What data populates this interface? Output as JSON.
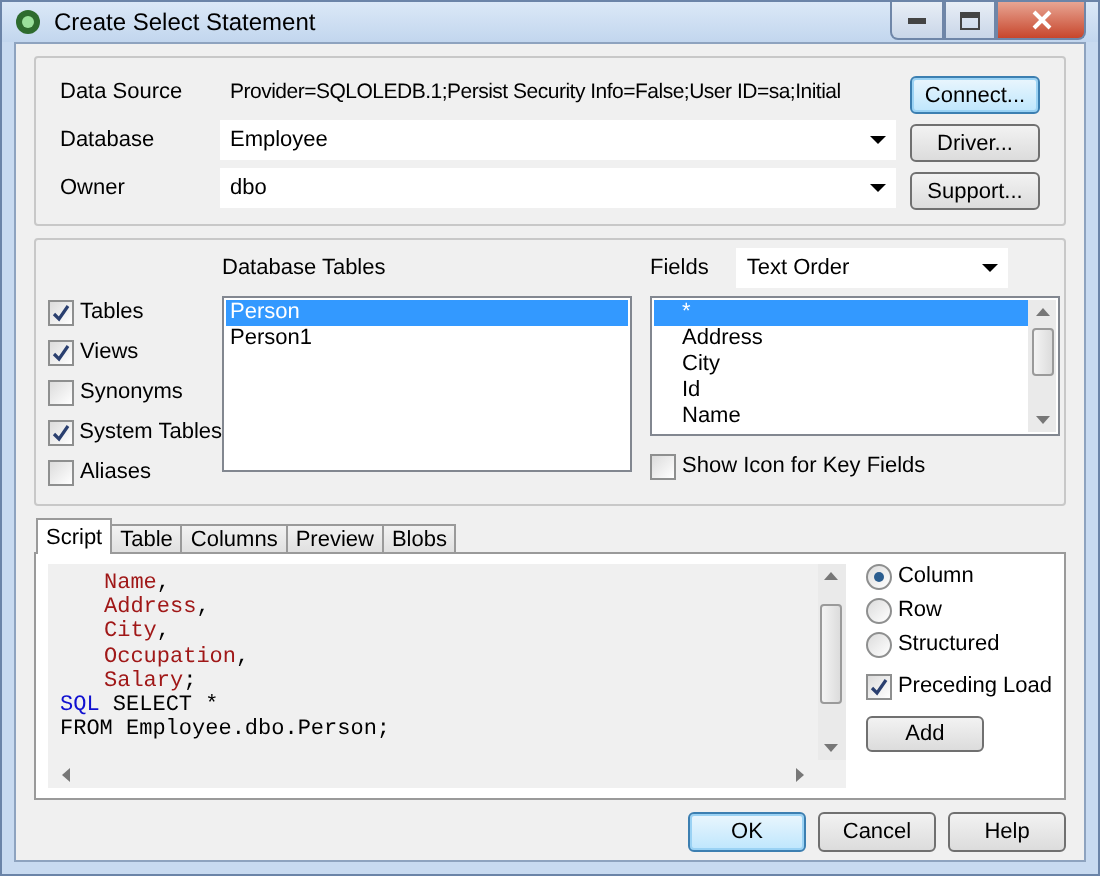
{
  "window": {
    "title": "Create Select Statement"
  },
  "connection": {
    "rows": [
      {
        "label": "Data Source",
        "kind": "readonly",
        "value": "Provider=SQLOLEDB.1;Persist Security Info=False;User ID=sa;Initial"
      },
      {
        "label": "Database",
        "kind": "dropdown",
        "value": "Employee"
      },
      {
        "label": "Owner",
        "kind": "dropdown",
        "value": "dbo"
      }
    ],
    "buttons": [
      {
        "label": "Connect...",
        "focused": true
      },
      {
        "label": "Driver...",
        "focused": false
      },
      {
        "label": "Support...",
        "focused": false
      }
    ]
  },
  "filters": [
    {
      "label": "Tables",
      "checked": true
    },
    {
      "label": "Views",
      "checked": true
    },
    {
      "label": "Synonyms",
      "checked": false
    },
    {
      "label": "System Tables",
      "checked": true
    },
    {
      "label": "Aliases",
      "checked": false
    }
  ],
  "database_tables": {
    "label": "Database Tables",
    "items": [
      {
        "label": "Person",
        "selected": true
      },
      {
        "label": "Person1",
        "selected": false
      }
    ]
  },
  "fields": {
    "label": "Fields",
    "order": "Text Order",
    "items": [
      {
        "label": "*",
        "selected": true
      },
      {
        "label": "Address",
        "selected": false
      },
      {
        "label": "City",
        "selected": false
      },
      {
        "label": "Id",
        "selected": false
      },
      {
        "label": "Name",
        "selected": false
      }
    ],
    "show_key_icon": {
      "label": "Show Icon for Key Fields",
      "checked": false
    }
  },
  "tabs": [
    {
      "label": "Script",
      "selected": true
    },
    {
      "label": "Table",
      "selected": false
    },
    {
      "label": "Columns",
      "selected": false
    },
    {
      "label": "Preview",
      "selected": false
    },
    {
      "label": "Blobs",
      "selected": false
    }
  ],
  "script": [
    {
      "indent": true,
      "tokens": [
        {
          "text": "Name",
          "kind": "field"
        },
        {
          "text": ",",
          "kind": "plain"
        }
      ]
    },
    {
      "indent": true,
      "tokens": [
        {
          "text": "Address",
          "kind": "field"
        },
        {
          "text": ",",
          "kind": "plain"
        }
      ]
    },
    {
      "indent": true,
      "tokens": [
        {
          "text": "City",
          "kind": "field"
        },
        {
          "text": ",",
          "kind": "plain"
        }
      ]
    },
    {
      "indent": true,
      "tokens": [
        {
          "text": "Occupation",
          "kind": "field"
        },
        {
          "text": ",",
          "kind": "plain"
        }
      ]
    },
    {
      "indent": true,
      "tokens": [
        {
          "text": "Salary",
          "kind": "field"
        },
        {
          "text": ";",
          "kind": "plain"
        }
      ]
    },
    {
      "indent": false,
      "tokens": [
        {
          "text": "SQL",
          "kind": "keyword"
        },
        {
          "text": " SELECT *",
          "kind": "plain"
        }
      ]
    },
    {
      "indent": false,
      "tokens": [
        {
          "text": "FROM Employee.dbo.Person;",
          "kind": "plain"
        }
      ]
    }
  ],
  "layout_options": [
    {
      "label": "Column",
      "selected": true
    },
    {
      "label": "Row",
      "selected": false
    },
    {
      "label": "Structured",
      "selected": false
    }
  ],
  "preceding_load": {
    "label": "Preceding Load",
    "checked": true
  },
  "add_button": "Add",
  "dialog_buttons": [
    {
      "label": "OK",
      "focused": true
    },
    {
      "label": "Cancel",
      "focused": false
    },
    {
      "label": "Help",
      "focused": false
    }
  ]
}
